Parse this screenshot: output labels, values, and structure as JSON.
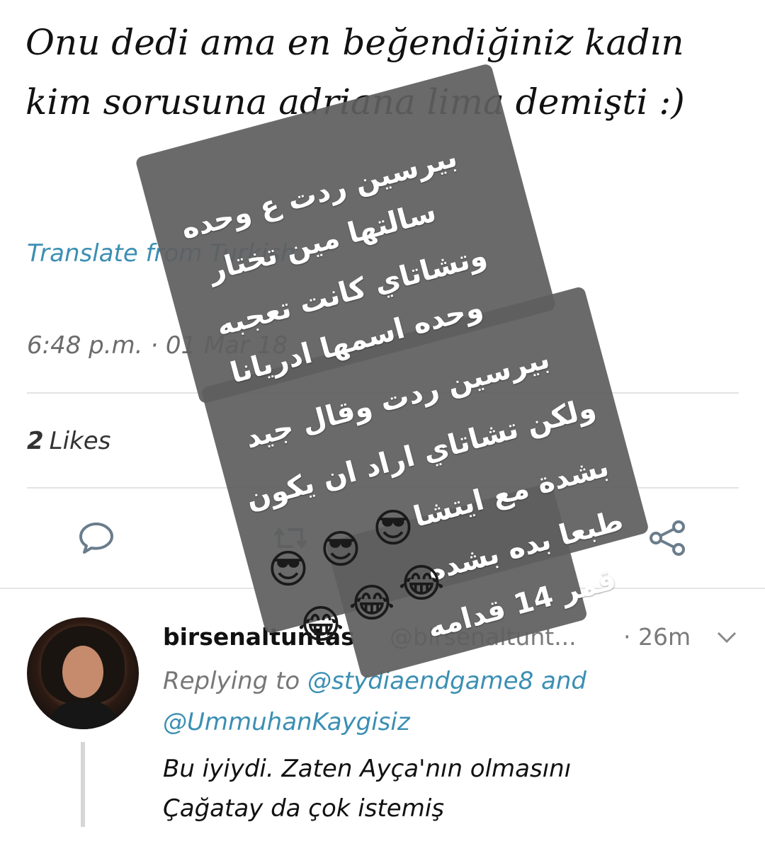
{
  "tweet": {
    "text": "Onu dedi ama en beğendiğiniz kadın kim sorusuna adriana lima demişti :)",
    "translate_link": "Translate from Turkish",
    "timestamp": "6:48 p.m. · 01 Mar 18",
    "likes_count": "2",
    "likes_label": "Likes"
  },
  "actions": {
    "icons": [
      "reply-icon",
      "retweet-icon",
      "heart-icon",
      "share-icon"
    ]
  },
  "reply": {
    "name": "birsenaltuntas",
    "handle": "@birsenaltunt...",
    "time": "· 26m",
    "replying_prefix": "Replying to",
    "replying_mention_1": "@stydiaendgame8",
    "replying_and": "and",
    "replying_mention_2": "@UmmuhanKaygisiz",
    "body_line_1": "Bu iyiydi. Zaten Ayça'nın olmasını",
    "body_line_2": "Çağatay da çok istemiş"
  },
  "overlay": {
    "lines": [
      "بيرسين ردت ع وحده",
      "سالتها مين تختار",
      "وتشاتاي كانت تعجبه",
      "وحده اسمها ادريانا",
      "بيرسين ردت وقال جيد",
      "ولكن تشاتاي اراد ان يكون",
      "بشدة مع ايتشا",
      "طبعا بده بشده",
      "قمر 14 قدامه"
    ],
    "emoji_cool": "😎",
    "emoji_laugh": "😂",
    "card_color": "#5f5f5f"
  },
  "colors": {
    "link": "#3b8fb3",
    "muted": "#6c6c6c",
    "divider": "#e3e3e3"
  }
}
